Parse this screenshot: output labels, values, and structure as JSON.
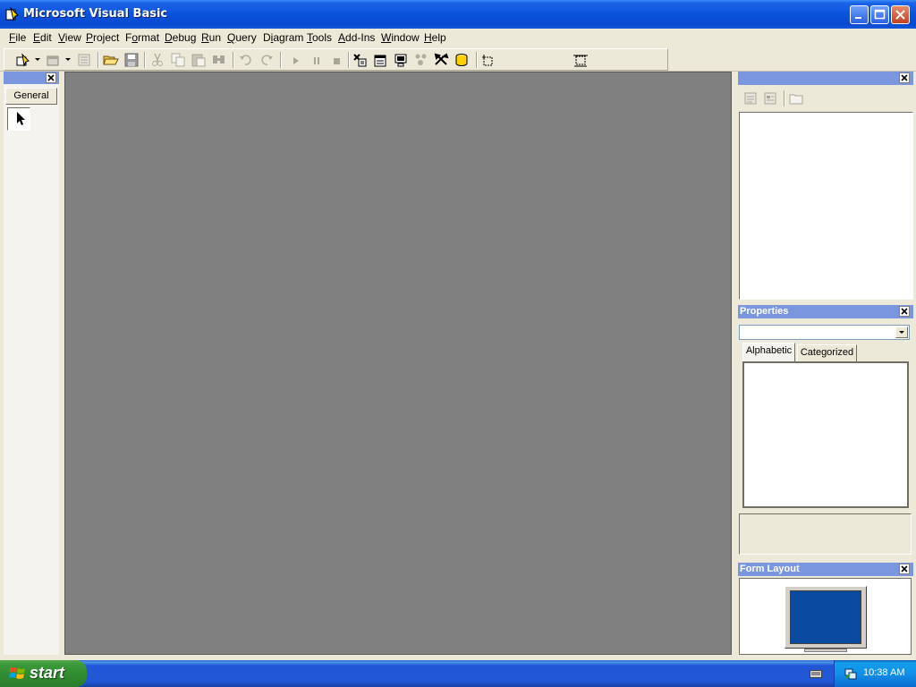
{
  "window": {
    "title": "Microsoft Visual Basic"
  },
  "menu": [
    {
      "label": "File",
      "accel": "F",
      "rest": "ile"
    },
    {
      "label": "Edit",
      "accel": "E",
      "rest": "dit"
    },
    {
      "label": "View",
      "accel": "V",
      "rest": "iew"
    },
    {
      "label": "Project",
      "accel": "P",
      "rest": "roject"
    },
    {
      "label": "Format",
      "accel": "o",
      "pre": "F",
      "rest": "rmat"
    },
    {
      "label": "Debug",
      "accel": "D",
      "rest": "ebug"
    },
    {
      "label": "Run",
      "accel": "R",
      "rest": "un"
    },
    {
      "label": "Query",
      "accel": "Q",
      "rest": "uery"
    },
    {
      "label": "Diagram",
      "accel": "i",
      "pre": "D",
      "rest": "agram"
    },
    {
      "label": "Tools",
      "accel": "T",
      "rest": "ools"
    },
    {
      "label": "Add-Ins",
      "accel": "A",
      "rest": "dd-Ins"
    },
    {
      "label": "Window",
      "accel": "W",
      "rest": "indow"
    },
    {
      "label": "Help",
      "accel": "H",
      "rest": "elp"
    }
  ],
  "toolbox": {
    "tab_label": "General"
  },
  "panels": {
    "properties": {
      "title": "Properties",
      "tabs": [
        "Alphabetic",
        "Categorized"
      ]
    },
    "form_layout": {
      "title": "Form Layout"
    }
  },
  "taskbar": {
    "start_label": "start",
    "clock": "10:38 AM"
  },
  "colors": {
    "titlebar": "#0a52dc",
    "mdi_background": "#808080",
    "panel_header": "#7a96df",
    "start_button": "#3c9a3a"
  }
}
